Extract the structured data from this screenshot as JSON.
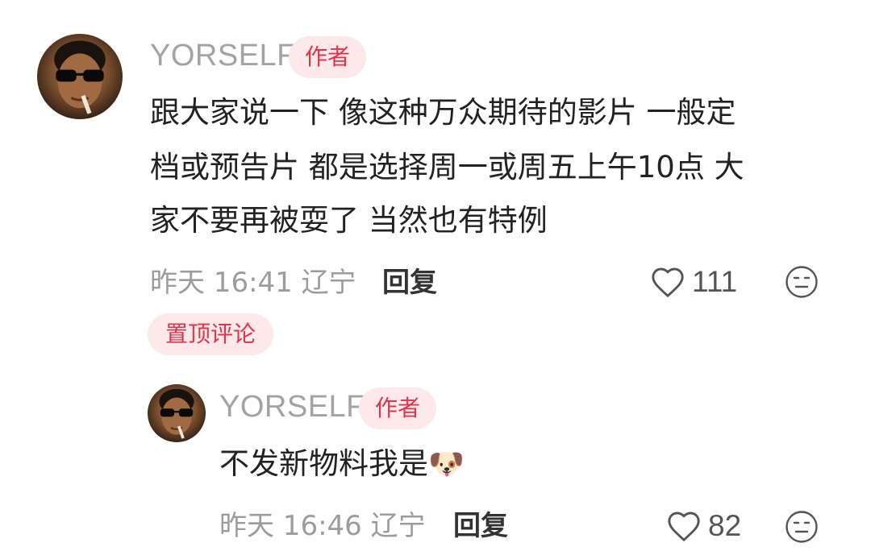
{
  "main_comment": {
    "avatar_icon": "avatar-man-sunglasses",
    "username": "YORSELF",
    "author_badge": "作者",
    "text_lines": [
      "跟大家说一下 像这种万众期待的影片 一般定",
      "档或预告片 都是选择周一或周五上午10点 大",
      "家不要再被耍了 当然也有特例"
    ],
    "time": "昨天 16:41",
    "location": "辽宁",
    "reply_label": "回复",
    "like_count": "111",
    "pinned_label": "置顶评论"
  },
  "reply_comment": {
    "avatar_icon": "avatar-man-sunglasses",
    "username": "YORSELF",
    "author_badge": "作者",
    "text": "不发新物料我是",
    "emoji": "🐶",
    "time": "昨天 16:46",
    "location": "辽宁",
    "reply_label": "回复",
    "like_count": "82"
  },
  "colors": {
    "badge_bg": "#fde8ea",
    "badge_text": "#e3334a",
    "meta_text": "#9c9c9c",
    "username": "#a3a3a3"
  }
}
